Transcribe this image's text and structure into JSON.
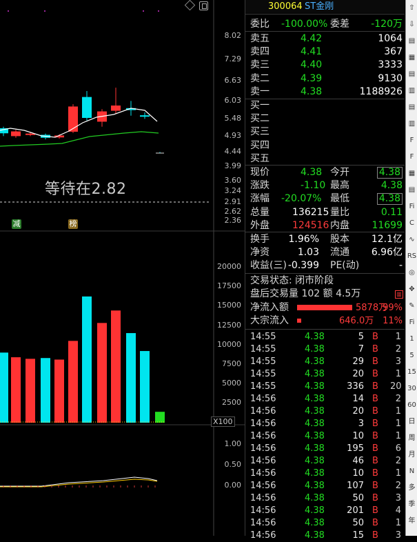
{
  "kline": {
    "price_labels": [
      "8.02",
      "7.29",
      "6.63",
      "6.03",
      "5.48",
      "4.93",
      "4.44",
      "3.99",
      "3.60",
      "3.24",
      "2.91",
      "2.62",
      "2.36"
    ],
    "waiting_text": "等待在2.82",
    "tags": [
      "减",
      "榜"
    ],
    "candles": [
      {
        "o": 4.99,
        "c": 5.15,
        "h": 5.2,
        "l": 4.9,
        "up": false
      },
      {
        "o": 5.05,
        "c": 4.9,
        "h": 5.1,
        "l": 4.85,
        "up": true
      },
      {
        "o": 4.98,
        "c": 4.95,
        "h": 5.02,
        "l": 4.9,
        "up": true
      },
      {
        "o": 4.94,
        "c": 4.85,
        "h": 4.98,
        "l": 4.8,
        "up": false
      },
      {
        "o": 4.86,
        "c": 4.92,
        "h": 4.96,
        "l": 4.82,
        "up": true
      },
      {
        "o": 5.04,
        "c": 5.83,
        "h": 5.9,
        "l": 5.0,
        "up": true
      },
      {
        "o": 5.48,
        "c": 6.12,
        "h": 6.3,
        "l": 5.4,
        "up": false
      },
      {
        "o": 5.36,
        "c": 5.68,
        "h": 5.75,
        "l": 5.2,
        "up": true
      },
      {
        "o": 5.7,
        "c": 5.86,
        "h": 6.4,
        "l": 5.6,
        "up": true
      },
      {
        "o": 5.78,
        "c": 5.72,
        "h": 6.0,
        "l": 5.55,
        "up": false
      },
      {
        "o": 5.56,
        "c": 5.52,
        "h": 5.65,
        "l": 5.45,
        "up": false
      },
      {
        "o": 4.41,
        "c": 4.38,
        "h": 4.41,
        "l": 4.38,
        "up": false
      }
    ]
  },
  "volume": {
    "labels": [
      "20000",
      "17500",
      "15000",
      "12500",
      "10000",
      "7500",
      "5000",
      "2500"
    ],
    "unit": "X100",
    "bars": [
      {
        "v": 9000,
        "up": false
      },
      {
        "v": 8400,
        "up": true
      },
      {
        "v": 8200,
        "up": true
      },
      {
        "v": 8300,
        "up": false
      },
      {
        "v": 8100,
        "up": true
      },
      {
        "v": 10500,
        "up": true
      },
      {
        "v": 16200,
        "up": false
      },
      {
        "v": 12800,
        "up": true
      },
      {
        "v": 14400,
        "up": true
      },
      {
        "v": 11500,
        "up": false
      },
      {
        "v": 9200,
        "up": false
      },
      {
        "v": 1400,
        "up": false
      }
    ]
  },
  "indicator": {
    "labels": [
      "1.00",
      "0.50",
      "0.00"
    ]
  },
  "quote": {
    "code": "300064",
    "name": "ST金刚",
    "weibi_label": "委比",
    "weibi_value": "-100.00%",
    "weicha_label": "委差",
    "weicha_value": "-120万",
    "asks": [
      {
        "label": "卖五",
        "price": "4.42",
        "vol": "1064"
      },
      {
        "label": "卖四",
        "price": "4.41",
        "vol": "367"
      },
      {
        "label": "卖三",
        "price": "4.40",
        "vol": "3333"
      },
      {
        "label": "卖二",
        "price": "4.39",
        "vol": "9130"
      },
      {
        "label": "卖一",
        "price": "4.38",
        "vol": "1188926"
      }
    ],
    "bids": [
      {
        "label": "买一"
      },
      {
        "label": "买二"
      },
      {
        "label": "买三"
      },
      {
        "label": "买四"
      },
      {
        "label": "买五"
      }
    ],
    "stats": [
      {
        "l1": "现价",
        "v1": "4.38",
        "c1": "green",
        "l2": "今开",
        "v2": "4.38",
        "c2": "green",
        "box2": true
      },
      {
        "l1": "涨跌",
        "v1": "-1.10",
        "c1": "green",
        "l2": "最高",
        "v2": "4.38",
        "c2": "green",
        "box2": false
      },
      {
        "l1": "涨幅",
        "v1": "-20.07%",
        "c1": "green",
        "l2": "最低",
        "v2": "4.38",
        "c2": "green",
        "box2": true
      },
      {
        "l1": "总量",
        "v1": "136215",
        "c1": "white",
        "l2": "量比",
        "v2": "0.11",
        "c2": "green",
        "box2": false
      },
      {
        "l1": "外盘",
        "v1": "124516",
        "c1": "red",
        "l2": "内盘",
        "v2": "11699",
        "c2": "green",
        "box2": false
      }
    ],
    "stats2": [
      {
        "l1": "换手",
        "v1": "1.96%",
        "l2": "股本",
        "v2": "12.1亿"
      },
      {
        "l1": "净资",
        "v1": "1.03",
        "l2": "流通",
        "v2": "6.96亿"
      },
      {
        "l1": "收益(三)",
        "v1": "-0.399",
        "l2": "PE(动)",
        "v2": "-"
      }
    ],
    "trade_status": "交易状态: 闭市阶段",
    "after_trade": "盘后交易量 102 额 4.5万",
    "net_inflow_label": "净流入额",
    "net_inflow_value": "5878万",
    "net_inflow_pct": "99%",
    "block_inflow_label": "大宗流入",
    "block_inflow_value": "646.0万",
    "block_inflow_pct": "11%"
  },
  "ticks": [
    {
      "t": "14:55",
      "p": "4.38",
      "v": "5",
      "b": "B",
      "n": "1"
    },
    {
      "t": "14:55",
      "p": "4.38",
      "v": "7",
      "b": "B",
      "n": "2"
    },
    {
      "t": "14:55",
      "p": "4.38",
      "v": "29",
      "b": "B",
      "n": "3"
    },
    {
      "t": "14:55",
      "p": "4.38",
      "v": "20",
      "b": "B",
      "n": "1"
    },
    {
      "t": "14:55",
      "p": "4.38",
      "v": "336",
      "b": "B",
      "n": "20"
    },
    {
      "t": "14:56",
      "p": "4.38",
      "v": "14",
      "b": "B",
      "n": "2"
    },
    {
      "t": "14:56",
      "p": "4.38",
      "v": "20",
      "b": "B",
      "n": "1"
    },
    {
      "t": "14:56",
      "p": "4.38",
      "v": "3",
      "b": "B",
      "n": "1"
    },
    {
      "t": "14:56",
      "p": "4.38",
      "v": "10",
      "b": "B",
      "n": "1"
    },
    {
      "t": "14:56",
      "p": "4.38",
      "v": "195",
      "b": "B",
      "n": "6"
    },
    {
      "t": "14:56",
      "p": "4.38",
      "v": "46",
      "b": "B",
      "n": "2"
    },
    {
      "t": "14:56",
      "p": "4.38",
      "v": "10",
      "b": "B",
      "n": "1"
    },
    {
      "t": "14:56",
      "p": "4.38",
      "v": "107",
      "b": "B",
      "n": "2"
    },
    {
      "t": "14:56",
      "p": "4.38",
      "v": "50",
      "b": "B",
      "n": "3"
    },
    {
      "t": "14:56",
      "p": "4.38",
      "v": "201",
      "b": "B",
      "n": "4"
    },
    {
      "t": "14:56",
      "p": "4.38",
      "v": "50",
      "b": "B",
      "n": "1"
    },
    {
      "t": "14:56",
      "p": "4.38",
      "v": "15",
      "b": "B",
      "n": "3"
    }
  ],
  "toolbar_items": [
    "⇧",
    "⇩",
    "▤",
    "▦",
    "▤",
    "▥",
    "▤",
    "▥",
    "F",
    "F",
    "▦",
    "▤",
    "Fi",
    "C",
    "∿",
    "RS",
    "◎",
    "✥",
    "✎",
    "Fi",
    "1",
    "5",
    "15",
    "30",
    "60",
    "日",
    "周",
    "月",
    "N",
    "多",
    "季",
    "年"
  ],
  "colors": {
    "up": "#ff3333",
    "down": "#00e5ee",
    "ma5": "#ffffff",
    "ma10": "#22cc22"
  }
}
